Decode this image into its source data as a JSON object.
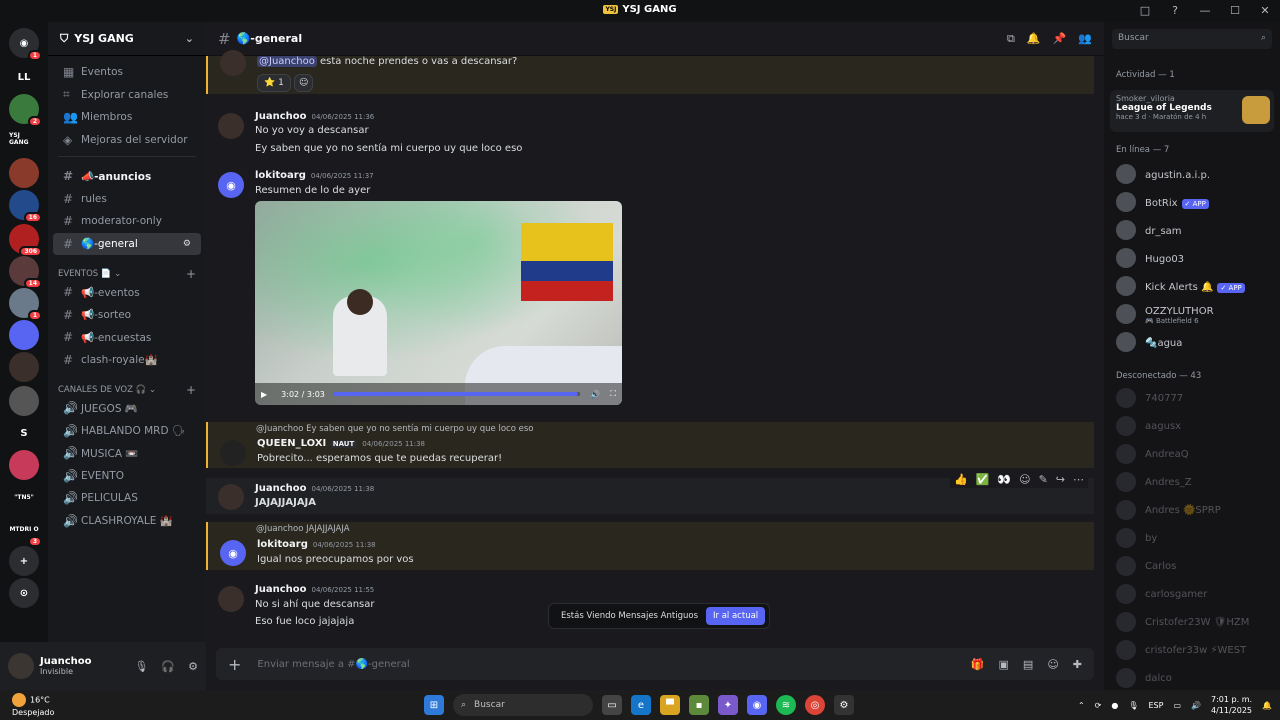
{
  "window": {
    "title": "YSJ GANG",
    "logo": "YSJ",
    "controls": [
      "□",
      "?",
      "—",
      "☐",
      "✕"
    ]
  },
  "guilds": [
    {
      "label": "◉",
      "badge": "1",
      "color": "#2b2d31",
      "icon": "discord-home-icon"
    },
    {
      "label": "LL",
      "badge": "",
      "color": "#111214",
      "icon": "server-ll"
    },
    {
      "label": "",
      "badge": "2",
      "color": "#3a7a3c",
      "icon": "server-green"
    },
    {
      "label": "YSJ GANG",
      "badge": "",
      "color": "#111214",
      "icon": "server-ysj"
    },
    {
      "label": "",
      "badge": "",
      "color": "#8a3a2a",
      "icon": "server-avatar"
    },
    {
      "label": "",
      "badge": "16",
      "color": "#234a8a",
      "icon": "server-blue"
    },
    {
      "label": "",
      "badge": "306",
      "color": "#b02020",
      "icon": "server-red"
    },
    {
      "label": "",
      "badge": "14",
      "color": "#5a3a3a",
      "icon": "server-brown"
    },
    {
      "label": "",
      "badge": "1",
      "color": "#6a7a8a",
      "icon": "server-grey"
    },
    {
      "label": "",
      "badge": "",
      "color": "#5865f2",
      "icon": "folder-icon"
    },
    {
      "label": "",
      "badge": "",
      "color": "#3a2f2a",
      "icon": "server-dark"
    },
    {
      "label": "",
      "badge": "",
      "color": "#555",
      "icon": "server-car"
    },
    {
      "label": "S",
      "badge": "",
      "color": "#111214",
      "icon": "server-s"
    },
    {
      "label": "",
      "badge": "",
      "color": "#c83a5a",
      "icon": "server-pink"
    },
    {
      "label": "\"TN5\"",
      "badge": "",
      "color": "#111214",
      "icon": "server-tn5"
    },
    {
      "label": "MTDRI O",
      "badge": "3",
      "color": "#111214",
      "icon": "server-mtdrio"
    },
    {
      "label": "+",
      "badge": "",
      "color": "#2b2d31",
      "icon": "add-server-icon"
    },
    {
      "label": "⊙",
      "badge": "",
      "color": "#2b2d31",
      "icon": "explore-icon"
    }
  ],
  "server": {
    "name": "YSJ GANG"
  },
  "nav": [
    {
      "icon": "▦",
      "label": "Eventos"
    },
    {
      "icon": "⌗",
      "label": "Explorar canales"
    },
    {
      "icon": "👥",
      "label": "Miembros"
    },
    {
      "icon": "◈",
      "label": "Mejoras del servidor"
    }
  ],
  "text_channels": [
    {
      "label": "📣-anuncios",
      "bold": true,
      "active": false
    },
    {
      "label": "rules",
      "bold": false,
      "active": false
    },
    {
      "label": "moderator-only",
      "bold": false,
      "active": false
    },
    {
      "label": "🌎-general",
      "bold": false,
      "active": true
    }
  ],
  "eventos_category": "EVENTOS 📄",
  "event_channels": [
    "📢-eventos",
    "📢-sorteo",
    "📢-encuestas",
    "clash-royale🏰"
  ],
  "voice_category": "CANALES DE VOZ 🎧",
  "voice_channels": [
    "JUEGOS 🎮",
    "HABLANDO MRD 🗣",
    "MUSICA 📼",
    "EVENTO",
    "PELICULAS",
    "CLASHROYALE 🏰"
  ],
  "user": {
    "name": "Juanchoo",
    "status": "Invisible"
  },
  "chat": {
    "channel": "🌎-general",
    "placeholder": "Enviar mensaje a #🌎-general",
    "messages": {
      "m0": {
        "mention": "@Juanchoo",
        "text": "esta noche prendes o vas a descansar?",
        "reaction": "⭐ 1"
      },
      "m1": {
        "author": "Juanchoo",
        "time": "04/06/2025 11:36",
        "l1": "No yo voy a descansar",
        "l2": "Ey saben que yo no sentía mi cuerpo uy que loco eso"
      },
      "m2": {
        "author": "lokitoarg",
        "time": "04/06/2025 11:37",
        "l1": "Resumen de lo de ayer",
        "video_time": "3:02 / 3:03",
        "progress": 0.99
      },
      "m3": {
        "reply": "@Juanchoo Ey saben que yo no sentía mi cuerpo uy que loco eso",
        "author": "QUEEN_LOXI",
        "tag": "NAUT",
        "time": "04/06/2025 11:38",
        "l1": "Pobrecito... esperamos que te puedas recuperar!"
      },
      "m4": {
        "author": "Juanchoo",
        "time": "04/06/2025 11:38",
        "l1": "JAJAJJAJAJA"
      },
      "m5": {
        "reply": "@Juanchoo JAJAJJAJAJA",
        "author": "lokitoarg",
        "time": "04/06/2025 11:38",
        "l1": "Igual nos preocupamos por vos"
      },
      "m6": {
        "author": "Juanchoo",
        "time": "04/06/2025 11:55",
        "l1": "No si ahí que descansar",
        "l2": "Eso fue loco jajajaja"
      }
    },
    "toast": {
      "text": "Estás Viendo Mensajes Antiguos",
      "button": "Ir al actual"
    }
  },
  "members": {
    "search": "Buscar",
    "activity_header": "Actividad — 1",
    "activity": {
      "user": "Smoker_viloria",
      "game": "League of Legends",
      "detail": "hace 3 d · Maratón de 4 h"
    },
    "online_header": "En línea — 7",
    "online": [
      {
        "name": "agustin.a.i.p.",
        "sub": "",
        "app": ""
      },
      {
        "name": "BotRix",
        "sub": "",
        "app": "✓ APP"
      },
      {
        "name": "dr_sam",
        "sub": "",
        "app": ""
      },
      {
        "name": "Hugo03",
        "sub": "",
        "app": ""
      },
      {
        "name": "Kick Alerts 🔔",
        "sub": "",
        "app": "✓ APP"
      },
      {
        "name": "OZZYLUTHOR",
        "sub": "🎮 Battlefield 6",
        "app": ""
      },
      {
        "name": "🔩agua",
        "sub": "",
        "app": ""
      }
    ],
    "offline_header": "Desconectado — 43",
    "offline": [
      "740777",
      "aagusx",
      "AndreaQ",
      "Andres_Z",
      "Andres 🌞SPRP",
      "by",
      "Carlos",
      "carlosgamer",
      "Cristofer23W 🛡HZM",
      "cristofer33w ⚡WEST",
      "dalco"
    ]
  },
  "taskbar": {
    "temp": "16°C",
    "weather": "Despejado",
    "search": "Buscar",
    "lang": "ESP",
    "time": "7:01 p. m.",
    "date": "4/11/2025"
  }
}
